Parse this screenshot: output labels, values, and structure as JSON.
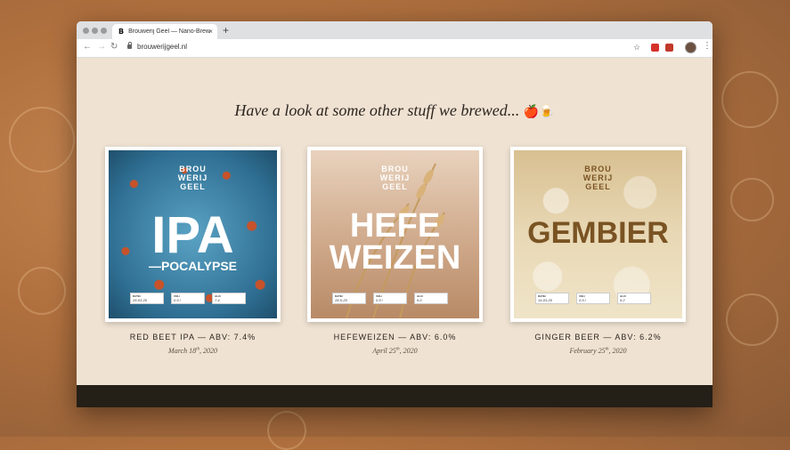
{
  "browser": {
    "tab_favicon": "B",
    "tab_title": "Brouwerij Geel — Nano-Brewery",
    "tab_close": "×",
    "new_tab": "+",
    "url": "brouwerijgeel.nl"
  },
  "page": {
    "headline": "Have a look at some other stuff we brewed...",
    "headline_emoji": "🍎🍺"
  },
  "brand_label": [
    "BROU",
    "WERIJ",
    "GEEL"
  ],
  "label_fields": {
    "date": "DATE/",
    "vol": "VOL/",
    "alc": "ALC/"
  },
  "beers": [
    {
      "label_big": "IPA",
      "label_sub": "—POCALYPSE",
      "caption": "RED BEET IPA — ABV: 7.4%",
      "date_prefix": "March 18",
      "date_suffix": "th",
      "date_year": ", 2020",
      "field_date": "28-03-20",
      "field_vol": "0.5 l",
      "field_alc": "7.4"
    },
    {
      "label_big": "HEFE",
      "label_sub": "WEIZEN",
      "caption": "HEFEWEIZEN — ABV: 6.0%",
      "date_prefix": "April 25",
      "date_suffix": "th",
      "date_year": ", 2020",
      "field_date": "28-5-20",
      "field_vol": "0.5 l",
      "field_alc": "6.0"
    },
    {
      "label_big": "GEMBIER",
      "label_sub": "",
      "caption": "GINGER BEER — ABV: 6.2%",
      "date_prefix": "February 25",
      "date_suffix": "th",
      "date_year": ", 2020",
      "field_date": "14-03-20",
      "field_vol": "0.5 l",
      "field_alc": "6.2"
    }
  ],
  "colors": {
    "page_bg": "#efe2d2",
    "footer": "#241f17",
    "ipa_label": "#3f86a8",
    "ipa_dots": "#c8522a",
    "wheat_label": "#c9a07e",
    "ginger_label": "#e5d3ae",
    "gembier_text": "#7a5323"
  }
}
